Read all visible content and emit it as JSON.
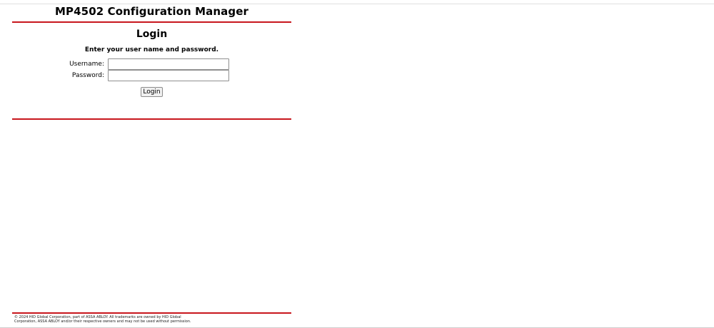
{
  "header": {
    "title": "MP4502 Configuration Manager"
  },
  "login": {
    "heading": "Login",
    "instructions": "Enter your user name and password.",
    "username_label": "Username:",
    "username_value": "",
    "password_label": "Password:",
    "password_value": "",
    "button_label": "Login"
  },
  "footer": {
    "line1": "© 2024 HID Global Corporation, part of ASSA ABLOY. All trademarks are owned by HID Global",
    "line2": "Corporation, ASSA ABLOY and/or their respective owners and may not be used without permission."
  },
  "colors": {
    "accent_rule": "#c8161d",
    "background": "#ffffff",
    "text": "#000000"
  }
}
